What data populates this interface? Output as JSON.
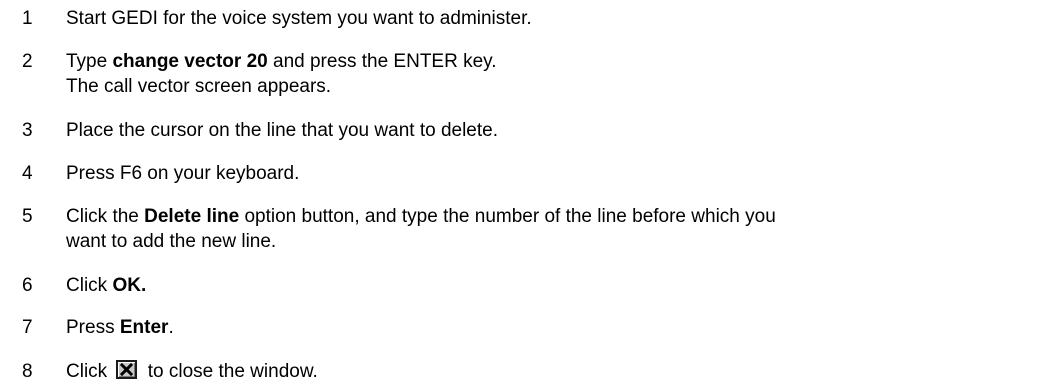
{
  "steps": [
    {
      "num": "1",
      "parts": [
        "Start GEDI for the voice system you want to administer."
      ]
    },
    {
      "num": "2",
      "parts": [
        "Type ",
        "change vector 20",
        " and press the ENTER key."
      ],
      "line2": "The call vector screen appears."
    },
    {
      "num": "3",
      "parts": [
        "Place the cursor on the line that you want to delete."
      ]
    },
    {
      "num": "4",
      "parts": [
        "Press F6 on your keyboard."
      ]
    },
    {
      "num": "5",
      "parts": [
        "Click the ",
        "Delete line",
        " option button, and type the number of the line before which you"
      ],
      "line2": "want to add the new line."
    },
    {
      "num": "6",
      "parts": [
        "Click ",
        "OK."
      ]
    },
    {
      "num": "7",
      "parts": [
        "Press ",
        "Enter",
        "."
      ]
    },
    {
      "num": "8",
      "parts": [
        "Click ",
        " to close the window."
      ],
      "icon": "close-window-icon"
    }
  ]
}
